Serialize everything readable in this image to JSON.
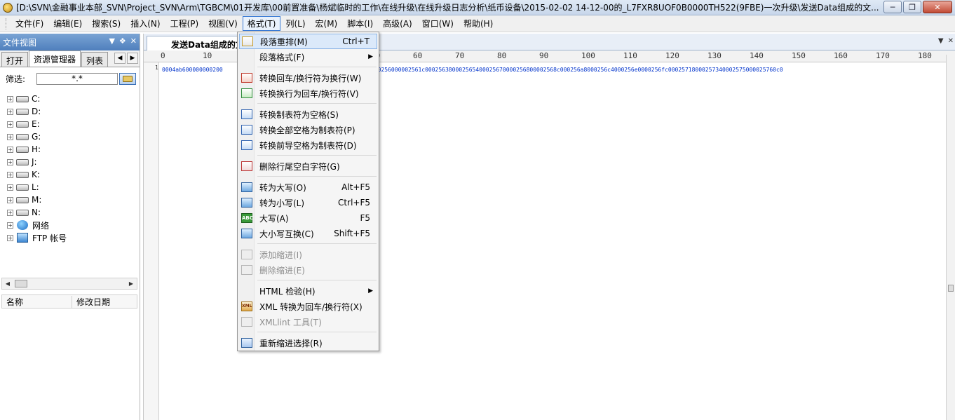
{
  "window": {
    "title": "[D:\\SVN\\金融事业本部_SVN\\Project_SVN\\Arm\\TGBCM\\01开发库\\00前置准备\\杨斌临时的工作\\在线升级\\在线升级日志分析\\纸币设备\\2015-02-02 14-12-00的_L7FXR8UOF0B0000TH522(9FBE)一次升级\\发送Data组成的文..."
  },
  "menubar": {
    "items": [
      "文件(F)",
      "编辑(E)",
      "搜索(S)",
      "插入(N)",
      "工程(P)",
      "视图(V)",
      "格式(T)",
      "列(L)",
      "宏(M)",
      "脚本(I)",
      "高级(A)",
      "窗口(W)",
      "帮助(H)"
    ],
    "active_index": 6
  },
  "left_panel": {
    "title": "文件视图",
    "tabs": [
      "打开",
      "资源管理器",
      "列表"
    ],
    "active_tab": 1,
    "filter_label": "筛选:",
    "filter_value": "*.*",
    "tree": [
      {
        "label": "C:",
        "icon": "drive-icon"
      },
      {
        "label": "D:",
        "icon": "drive-icon"
      },
      {
        "label": "E:",
        "icon": "drive-icon"
      },
      {
        "label": "G:",
        "icon": "network-drive-icon"
      },
      {
        "label": "H:",
        "icon": "network-drive-icon"
      },
      {
        "label": "J:",
        "icon": "network-drive-icon"
      },
      {
        "label": "K:",
        "icon": "drive-icon"
      },
      {
        "label": "L:",
        "icon": "drive-icon"
      },
      {
        "label": "M:",
        "icon": "drive-icon"
      },
      {
        "label": "N:",
        "icon": "drive-icon"
      },
      {
        "label": "网络",
        "icon": "network-icon"
      },
      {
        "label": "FTP 帐号",
        "icon": "ftp-icon"
      }
    ],
    "list_headers": {
      "name": "名称",
      "date": "修改日期"
    }
  },
  "editor": {
    "tab_title": "发送Data组成的文",
    "ruler_labels": [
      "0",
      "10",
      "20",
      "30",
      "40",
      "50",
      "60",
      "70",
      "80",
      "90",
      "100",
      "110",
      "120",
      "130",
      "140",
      "150",
      "160",
      "170",
      "180"
    ],
    "line_numbers": [
      "1"
    ],
    "line_1_start": "0004ab600000000200",
    "line_1_end": "55ac000255c8000255e4000256000002561c000256380002565400025670000256800002568c000256a8000256c4000256e0000256fc00025718000257340002575000025760c0"
  },
  "format_menu": {
    "items": [
      {
        "label": "段落重排(M)",
        "shortcut": "Ctrl+T",
        "icon": "paragraph-reflow-icon",
        "highlighted": true
      },
      {
        "label": "段落格式(F)",
        "submenu": true
      },
      {
        "sep": true
      },
      {
        "label": "转换回车/换行符为换行(W)",
        "icon": "convert-crlf-icon"
      },
      {
        "label": "转换换行为回车/换行符(V)",
        "icon": "convert-lf-icon"
      },
      {
        "sep": true
      },
      {
        "label": "转换制表符为空格(S)",
        "icon": "tab-to-space-icon"
      },
      {
        "label": "转换全部空格为制表符(P)",
        "icon": "space-to-tab-icon"
      },
      {
        "label": "转换前导空格为制表符(D)",
        "icon": "leading-space-tab-icon"
      },
      {
        "sep": true
      },
      {
        "label": "删除行尾空白字符(G)",
        "icon": "trim-trailing-icon"
      },
      {
        "sep": true
      },
      {
        "label": "转为大写(O)",
        "shortcut": "Alt+F5",
        "icon": "uppercase-icon"
      },
      {
        "label": "转为小写(L)",
        "shortcut": "Ctrl+F5",
        "icon": "lowercase-icon"
      },
      {
        "label": "大写(A)",
        "shortcut": "F5",
        "icon": "capitalize-icon"
      },
      {
        "label": "大小写互换(C)",
        "shortcut": "Shift+F5",
        "icon": "swap-case-icon"
      },
      {
        "sep": true
      },
      {
        "label": "添加缩进(I)",
        "disabled": true,
        "icon": "add-indent-icon"
      },
      {
        "label": "删除缩进(E)",
        "disabled": true,
        "icon": "remove-indent-icon"
      },
      {
        "sep": true
      },
      {
        "label": "HTML 检验(H)",
        "submenu": true
      },
      {
        "label": "XML 转换为回车/换行符(X)",
        "icon": "xml-icon"
      },
      {
        "label": "XMLlint 工具(T)",
        "disabled": true,
        "icon": "xmllint-icon"
      },
      {
        "sep": true
      },
      {
        "label": "重新缩进选择(R)",
        "icon": "reindent-icon"
      }
    ]
  }
}
